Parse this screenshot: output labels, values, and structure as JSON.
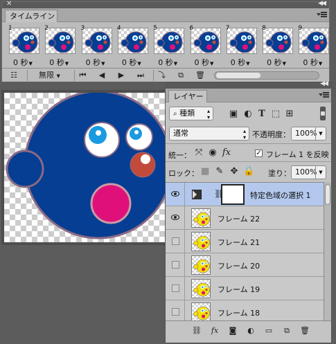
{
  "timeline": {
    "tab_label": "タイムライン",
    "frames": [
      {
        "number": "1",
        "delay": "0 秒"
      },
      {
        "number": "2",
        "delay": "0 秒"
      },
      {
        "number": "3",
        "delay": "0 秒"
      },
      {
        "number": "4",
        "delay": "0 秒"
      },
      {
        "number": "5",
        "delay": "0 秒"
      },
      {
        "number": "6",
        "delay": "0 秒"
      },
      {
        "number": "7",
        "delay": "0 秒"
      },
      {
        "number": "8",
        "delay": "0 秒"
      },
      {
        "number": "9",
        "delay": "0 秒"
      }
    ],
    "loop_label": "無限",
    "controls": {
      "first_frame_icon": "⏮",
      "prev_frame_icon": "◀",
      "play_icon": "▶",
      "next_frame_icon": "⏭"
    }
  },
  "layers_panel": {
    "tab_label": "レイヤー",
    "filter_kind": "種類",
    "blend_mode": "通常",
    "opacity_label": "不透明度：",
    "opacity_value": "100%",
    "unify_label": "統一：",
    "propagate_label": "フレーム 1 を反映",
    "lock_label": "ロック：",
    "fill_label": "塗り：",
    "fill_value": "100%",
    "layers": [
      {
        "name": "特定色域の選択 1",
        "visible": true,
        "selected": true,
        "type": "adjustment"
      },
      {
        "name": "フレーム 22",
        "visible": true,
        "selected": false,
        "type": "pixel"
      },
      {
        "name": "フレーム 21",
        "visible": false,
        "selected": false,
        "type": "pixel"
      },
      {
        "name": "フレーム 20",
        "visible": false,
        "selected": false,
        "type": "pixel"
      },
      {
        "name": "フレーム 19",
        "visible": false,
        "selected": false,
        "type": "pixel"
      },
      {
        "name": "フレーム 18",
        "visible": false,
        "selected": false,
        "type": "pixel"
      }
    ]
  },
  "colors": {
    "face_blue": "#053e93",
    "face_outline": "#8a6a85",
    "mouth_pink": "#e0107a",
    "cheek_red": "#c24a3a",
    "eye_cyan": "#1a9ae0",
    "thumb_yellow": "#f2e300",
    "selected_row": "#b3c8ec"
  }
}
